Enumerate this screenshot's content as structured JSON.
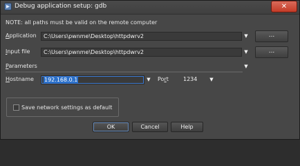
{
  "window": {
    "title": "Debug application setup: gdb",
    "close_glyph": "✕"
  },
  "note": "NOTE: all paths must be valid on the remote computer",
  "fields": {
    "application": {
      "label_pre": "",
      "label_u": "A",
      "label_post": "pplication",
      "value": "C:\\Users\\pwnme\\Desktop\\httpdwrv2",
      "browse": "..."
    },
    "input_file": {
      "label_pre": "",
      "label_u": "I",
      "label_post": "nput file",
      "value": "C:\\Users\\pwnme\\Desktop\\httpdwrv2",
      "browse": "..."
    },
    "parameters": {
      "label_pre": "",
      "label_u": "P",
      "label_post": "arameters",
      "value": ""
    },
    "hostname": {
      "label_pre": "",
      "label_u": "H",
      "label_post": "ostname",
      "value": "192.168.0.1"
    },
    "port": {
      "label_pre": "Po",
      "label_u": "r",
      "label_post": "t",
      "value": "1234"
    }
  },
  "save_settings": {
    "label": "Save network settings as default",
    "checked": false
  },
  "buttons": {
    "ok": "OK",
    "cancel": "Cancel",
    "help": "Help"
  },
  "icons": {
    "app": "debugger-icon",
    "dropdown": "chevron-down-icon"
  }
}
